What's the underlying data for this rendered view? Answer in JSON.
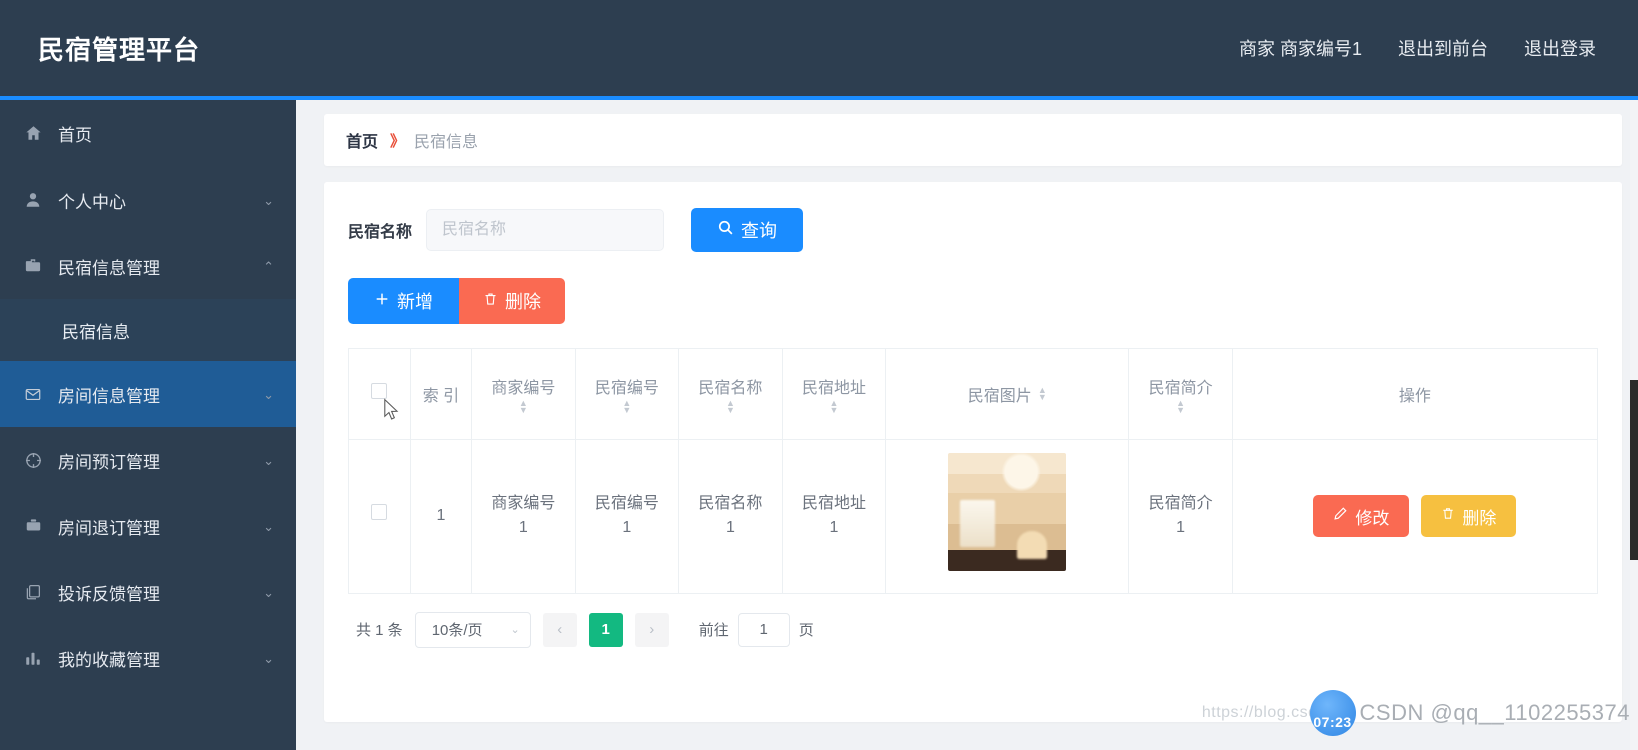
{
  "header": {
    "brand": "民宿管理平台",
    "nav": [
      {
        "label": "商家 商家编号1",
        "name": "merchant-account"
      },
      {
        "label": "退出到前台",
        "name": "exit-to-front"
      },
      {
        "label": "退出登录",
        "name": "logout"
      }
    ]
  },
  "sidebar": {
    "items": [
      {
        "label": "首页",
        "icon": "home-icon",
        "arrow": "",
        "state": "normal"
      },
      {
        "label": "个人中心",
        "icon": "user-icon",
        "arrow": "⌄",
        "state": "normal"
      },
      {
        "label": "民宿信息管理",
        "icon": "briefcase-icon",
        "arrow": "⌃",
        "state": "expanded"
      },
      {
        "label": "民宿信息",
        "icon": "",
        "arrow": "",
        "state": "submenu-active"
      },
      {
        "label": "房间信息管理",
        "icon": "mail-icon",
        "arrow": "⌄",
        "state": "hovered"
      },
      {
        "label": "房间预订管理",
        "icon": "compass-icon",
        "arrow": "⌄",
        "state": "normal"
      },
      {
        "label": "房间退订管理",
        "icon": "suitcase-icon",
        "arrow": "⌄",
        "state": "normal"
      },
      {
        "label": "投诉反馈管理",
        "icon": "copy-icon",
        "arrow": "⌄",
        "state": "normal"
      },
      {
        "label": "我的收藏管理",
        "icon": "chart-icon",
        "arrow": "⌄",
        "state": "normal"
      }
    ]
  },
  "breadcrumb": {
    "home": "首页",
    "separator": "》",
    "current": "民宿信息"
  },
  "search": {
    "label": "民宿名称",
    "placeholder": "民宿名称",
    "value": "",
    "query_button": "查询"
  },
  "toolbar": {
    "add_label": "新增",
    "delete_label": "删除"
  },
  "table": {
    "columns": [
      {
        "label": "",
        "name": "select-all",
        "sortable": false
      },
      {
        "label": "索 引",
        "name": "index",
        "sortable": true
      },
      {
        "label": "商家编号",
        "name": "merchant-no",
        "sortable": true
      },
      {
        "label": "民宿编号",
        "name": "homestay-no",
        "sortable": true
      },
      {
        "label": "民宿名称",
        "name": "homestay-name",
        "sortable": true
      },
      {
        "label": "民宿地址",
        "name": "homestay-address",
        "sortable": true
      },
      {
        "label": "民宿图片",
        "name": "homestay-image",
        "sortable": true
      },
      {
        "label": "民宿简介",
        "name": "homestay-intro",
        "sortable": true
      },
      {
        "label": "操作",
        "name": "operations",
        "sortable": false
      }
    ],
    "rows": [
      {
        "index": "1",
        "merchant_no": "商家编号\n1",
        "homestay_no": "民宿编号\n1",
        "homestay_name": "民宿名称\n1",
        "homestay_address": "民宿地址\n1",
        "homestay_intro": "民宿简介\n1",
        "edit_label": "修改",
        "delete_label": "删除"
      }
    ]
  },
  "pagination": {
    "total_text": "共 1 条",
    "page_size": "10条/页",
    "prev": "‹",
    "next": "›",
    "current_page": "1",
    "jump_prefix": "前往",
    "jump_value": "1",
    "jump_suffix": "页"
  },
  "watermark": {
    "url": "https://blog.csdn.net",
    "badge": "07:23",
    "text": "CSDN @qq__1102255374"
  },
  "colors": {
    "header_bg": "#2d3e50",
    "accent_blue": "#1a8cff",
    "danger": "#fa6a52",
    "warning": "#f6c040",
    "active_page": "#13b981"
  }
}
